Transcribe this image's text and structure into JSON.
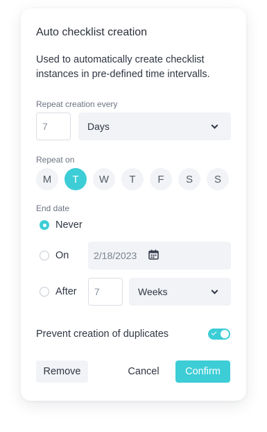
{
  "dialog": {
    "title": "Auto checklist creation",
    "description": "Used to automatically create checklist instances in pre-defined time intervalls."
  },
  "repeat_every": {
    "label": "Repeat creation every",
    "value": "7",
    "unit": "Days"
  },
  "repeat_on": {
    "label": "Repeat on",
    "days": [
      "M",
      "T",
      "W",
      "T",
      "F",
      "S",
      "S"
    ],
    "selected_index": 1
  },
  "end_date": {
    "label": "End date",
    "options": {
      "never": "Never",
      "on": "On",
      "after": "After"
    },
    "selected": "never",
    "on_date": "2/18/2023",
    "after_value": "7",
    "after_unit": "Weeks"
  },
  "prevent_duplicates": {
    "label": "Prevent creation of duplicates",
    "enabled": true
  },
  "buttons": {
    "remove": "Remove",
    "cancel": "Cancel",
    "confirm": "Confirm"
  },
  "colors": {
    "accent": "#3dcdd6",
    "field_bg": "#f1f3f6",
    "text": "#2f3542"
  }
}
